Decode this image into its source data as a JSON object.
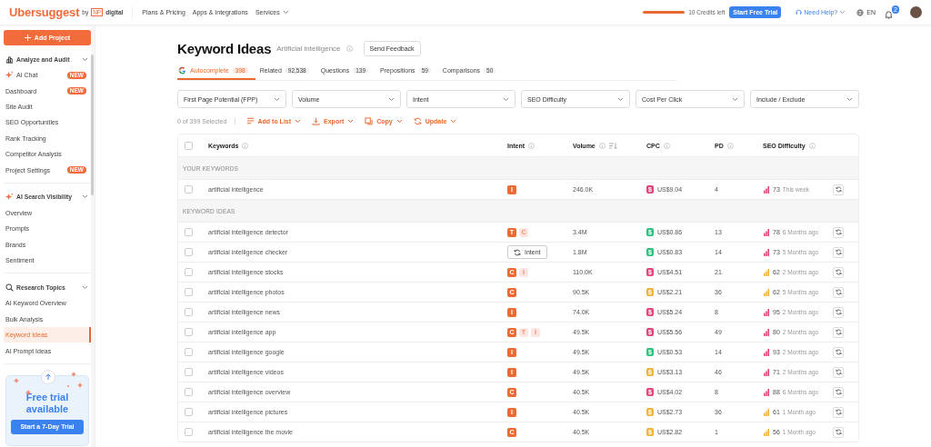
{
  "header": {
    "logo": "Ubersuggest",
    "logo_by": "by",
    "logo_badge": "NP",
    "logo_suffix": "digital",
    "nav": [
      {
        "label": "Plans & Pricing",
        "dropdown": false
      },
      {
        "label": "Apps & Integrations",
        "dropdown": false
      },
      {
        "label": "Services",
        "dropdown": true
      }
    ],
    "credits": {
      "level": 1,
      "label": "10 Credits left"
    },
    "trial_button": "Start Free Trial",
    "help": "Need Help?",
    "language": "EN",
    "notifications": "2"
  },
  "sidebar": {
    "add_button": "Add Project",
    "sections": [
      {
        "title": "Analyze and Audit",
        "expanded": true,
        "items": [
          {
            "label": "AI Chat",
            "badge": "NEW",
            "selected": false
          },
          {
            "label": "Dashboard",
            "badge": "NEW",
            "selected": false
          },
          {
            "label": "Site Audit",
            "selected": false
          },
          {
            "label": "SEO Opportunities",
            "selected": false
          },
          {
            "label": "Rank Tracking",
            "selected": false
          },
          {
            "label": "Competitor Analysis",
            "selected": false
          },
          {
            "label": "Project Settings",
            "badge": "NEW",
            "selected": false
          }
        ]
      },
      {
        "title": "AI Search Visibility",
        "expanded": true,
        "items": [
          {
            "label": "Overview",
            "selected": false
          },
          {
            "label": "Prompts",
            "selected": false
          },
          {
            "label": "Brands",
            "selected": false
          },
          {
            "label": "Sentiment",
            "selected": false
          }
        ]
      },
      {
        "title": "Research Topics",
        "expanded": true,
        "items": [
          {
            "label": "AI Keyword Overview",
            "selected": false
          },
          {
            "label": "Bulk Analysis",
            "selected": false
          },
          {
            "label": "Keyword Ideas",
            "selected": true
          },
          {
            "label": "AI Prompt Ideas",
            "selected": false
          }
        ]
      }
    ],
    "trial": {
      "title": "Free trial available",
      "button": "Start a 7-Day Trial"
    }
  },
  "main": {
    "title": "Keyword Ideas",
    "subtitle": "Artificial intelligence",
    "feedback_button": "Send Feedback",
    "tabs": [
      {
        "label": "Autocomplete",
        "count": "398",
        "selected": true
      },
      {
        "label": "Related",
        "count": "92,538",
        "selected": false
      },
      {
        "label": "Questions",
        "count": "139",
        "selected": false
      },
      {
        "label": "Prepositions",
        "count": "59",
        "selected": false
      },
      {
        "label": "Comparisons",
        "count": "50",
        "selected": false
      }
    ],
    "filters": [
      "First Page Potential (FPP)",
      "Volume",
      "Intent",
      "SEO Difficulty",
      "Cost Per Click",
      "Include / Exclude"
    ],
    "selection": "0 of 399 Selected",
    "actions": [
      "Add to List",
      "Export",
      "Copy",
      "Update"
    ],
    "table": {
      "all_checked": false,
      "columns": [
        {
          "label": "Keywords",
          "sortable": false
        },
        {
          "label": "Intent",
          "sortable": false
        },
        {
          "label": "Volume",
          "sortable": true
        },
        {
          "label": "CPC",
          "sortable": false
        },
        {
          "label": "PD",
          "sortable": false
        },
        {
          "label": "SEO Difficulty",
          "sortable": false
        }
      ],
      "sections": [
        {
          "title": "YOUR KEYWORDS",
          "rows": [
            {
              "keyword": "artificial intelligence",
              "checked": false,
              "intent": [
                {
                  "letter": "I",
                  "primary": true
                }
              ],
              "volume": "246.0K",
              "cpc": {
                "symbol": "$",
                "value": "US$9.04",
                "color": "#e0457b"
              },
              "pd": "4",
              "difficulty": {
                "value": "73",
                "color": "#e0457b",
                "updated": "This week"
              }
            }
          ]
        },
        {
          "title": "KEYWORD IDEAS",
          "rows": [
            {
              "keyword": "artificial intelligence detector",
              "checked": false,
              "intent": [
                {
                  "letter": "T",
                  "primary": true
                },
                {
                  "letter": "C",
                  "primary": false
                }
              ],
              "volume": "3.4M",
              "cpc": {
                "symbol": "$",
                "value": "US$0.86",
                "color": "#2ec27e"
              },
              "pd": "13",
              "difficulty": {
                "value": "78",
                "color": "#e0457b",
                "updated": "6 Months ago"
              }
            },
            {
              "keyword": "artificial intelligence checker",
              "checked": false,
              "intent": [],
              "intent_action": "Intent",
              "volume": "1.8M",
              "cpc": {
                "symbol": "$",
                "value": "US$0.83",
                "color": "#2ec27e"
              },
              "pd": "14",
              "difficulty": {
                "value": "73",
                "color": "#e0457b",
                "updated": "5 Months ago"
              }
            },
            {
              "keyword": "artificial intelligence stocks",
              "checked": false,
              "intent": [
                {
                  "letter": "C",
                  "primary": true
                },
                {
                  "letter": "I",
                  "primary": false
                }
              ],
              "volume": "110.0K",
              "cpc": {
                "symbol": "$",
                "value": "US$4.51",
                "color": "#e0457b"
              },
              "pd": "21",
              "difficulty": {
                "value": "62",
                "color": "#f0b43c",
                "updated": "2 Months ago"
              }
            },
            {
              "keyword": "artificial intelligence photos",
              "checked": false,
              "intent": [
                {
                  "letter": "C",
                  "primary": true
                }
              ],
              "volume": "90.5K",
              "cpc": {
                "symbol": "$",
                "value": "US$2.21",
                "color": "#f0b43c"
              },
              "pd": "36",
              "difficulty": {
                "value": "62",
                "color": "#f0b43c",
                "updated": "5 Months ago"
              }
            },
            {
              "keyword": "artificial intelligence news",
              "checked": false,
              "intent": [
                {
                  "letter": "I",
                  "primary": true
                }
              ],
              "volume": "74.0K",
              "cpc": {
                "symbol": "$",
                "value": "US$5.24",
                "color": "#e0457b"
              },
              "pd": "8",
              "difficulty": {
                "value": "95",
                "color": "#e0457b",
                "updated": "2 Months ago"
              }
            },
            {
              "keyword": "artificial intelligence app",
              "checked": false,
              "intent": [
                {
                  "letter": "C",
                  "primary": true
                },
                {
                  "letter": "T",
                  "primary": false
                },
                {
                  "letter": "I",
                  "primary": false
                }
              ],
              "volume": "49.5K",
              "cpc": {
                "symbol": "$",
                "value": "US$5.56",
                "color": "#e0457b"
              },
              "pd": "49",
              "difficulty": {
                "value": "80",
                "color": "#e0457b",
                "updated": "2 Months ago"
              }
            },
            {
              "keyword": "artificial intelligence google",
              "checked": false,
              "intent": [
                {
                  "letter": "I",
                  "primary": true
                }
              ],
              "volume": "49.5K",
              "cpc": {
                "symbol": "$",
                "value": "US$0.53",
                "color": "#2ec27e"
              },
              "pd": "14",
              "difficulty": {
                "value": "93",
                "color": "#e0457b",
                "updated": "2 Months ago"
              }
            },
            {
              "keyword": "artificial intelligence videos",
              "checked": false,
              "intent": [
                {
                  "letter": "I",
                  "primary": true
                }
              ],
              "volume": "49.5K",
              "cpc": {
                "symbol": "$",
                "value": "US$3.13",
                "color": "#f0b43c"
              },
              "pd": "46",
              "difficulty": {
                "value": "71",
                "color": "#e0457b",
                "updated": "2 Months ago"
              }
            },
            {
              "keyword": "artificial intelligence overview",
              "checked": false,
              "intent": [
                {
                  "letter": "C",
                  "primary": true
                }
              ],
              "volume": "40.5K",
              "cpc": {
                "symbol": "$",
                "value": "US$4.02",
                "color": "#e0457b"
              },
              "pd": "8",
              "difficulty": {
                "value": "88",
                "color": "#e0457b",
                "updated": "6 Months ago"
              }
            },
            {
              "keyword": "artificial intelligence pictures",
              "checked": false,
              "intent": [
                {
                  "letter": "I",
                  "primary": true
                }
              ],
              "volume": "40.5K",
              "cpc": {
                "symbol": "$",
                "value": "US$2.73",
                "color": "#f0b43c"
              },
              "pd": "36",
              "difficulty": {
                "value": "61",
                "color": "#f0b43c",
                "updated": "1 Month ago"
              }
            },
            {
              "keyword": "artificial intelligence the movie",
              "checked": false,
              "intent": [
                {
                  "letter": "C",
                  "primary": true
                }
              ],
              "volume": "40.5K",
              "cpc": {
                "symbol": "$",
                "value": "US$2.82",
                "color": "#f0b43c"
              },
              "pd": "1",
              "difficulty": {
                "value": "56",
                "color": "#f0b43c",
                "updated": "1 Month ago"
              }
            }
          ]
        }
      ]
    }
  }
}
